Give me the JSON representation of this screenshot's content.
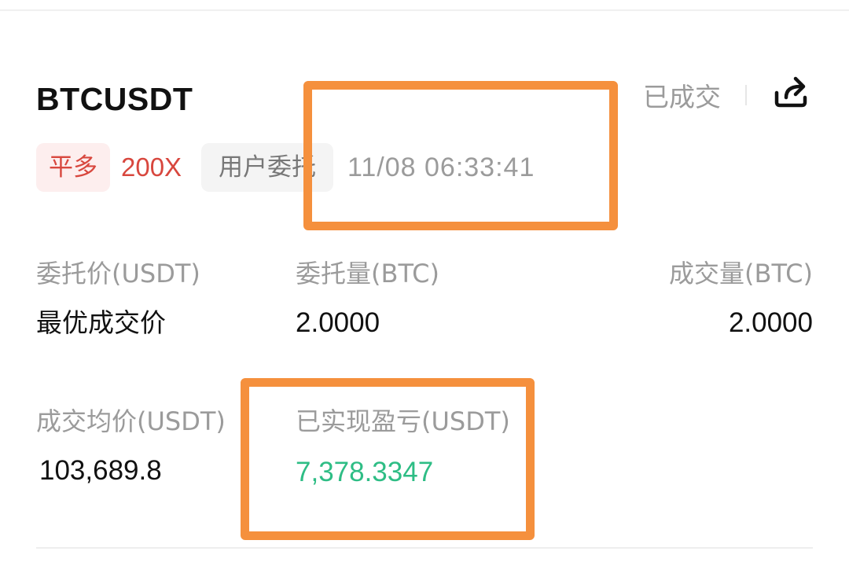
{
  "order": {
    "symbol": "BTCUSDT",
    "status": "已成交",
    "side": "平多",
    "leverage": "200X",
    "order_type": "用户委托",
    "time": "11/08 06:33:41"
  },
  "fields": {
    "order_price": {
      "label": "委托价(USDT)",
      "value": "最优成交价"
    },
    "order_qty": {
      "label": "委托量(BTC)",
      "value": "2.0000"
    },
    "filled_qty": {
      "label": "成交量(BTC)",
      "value": "2.0000"
    },
    "avg_price": {
      "label": "成交均价(USDT)",
      "value": "103,689.8"
    },
    "realized_pnl": {
      "label": "已实现盈亏(USDT)",
      "value": "7,378.3347"
    }
  },
  "icons": {
    "share": "share-icon"
  },
  "colors": {
    "sell_red": "#d8473e",
    "profit_green": "#2ebd85",
    "highlight_orange": "#f5903d",
    "muted_gray": "#9b9b9b"
  }
}
